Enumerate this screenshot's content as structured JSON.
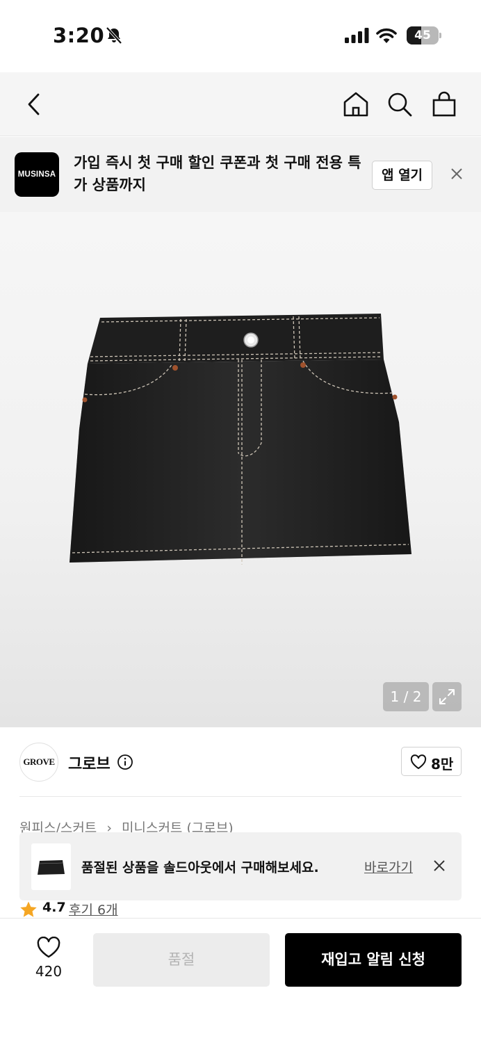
{
  "status_bar": {
    "time": "3:20",
    "battery_percent": "45",
    "battery_level": 0.45
  },
  "nav": {
    "icons": [
      "back-icon",
      "home-icon",
      "search-icon",
      "cart-icon"
    ]
  },
  "app_banner": {
    "logo_text": "MUSINSA",
    "message": "가입 즉시 첫 구매 할인 쿠폰과 첫 구매 전용 특가 상품까지",
    "open_label": "앱 열기"
  },
  "gallery": {
    "page_indicator": "1 / 2"
  },
  "brand": {
    "logo_text": "GROVE",
    "name": "그로브",
    "likes": "8만"
  },
  "breadcrumb": {
    "category": "원피스/스커트",
    "subcategory": "미니스커트 (그로브)"
  },
  "toast": {
    "message": "품절된 상품을 솔드아웃에서 구매해보세요.",
    "link_label": "바로가기"
  },
  "rating": {
    "value": "4.7",
    "review_label": "후기 6개"
  },
  "bottom_bar": {
    "wish_count": "420",
    "soldout_label": "품절",
    "restock_label": "재입고 알림 신청"
  },
  "colors": {
    "accent": "#000000",
    "star": "#f5a623",
    "disabled_bg": "#ececec"
  }
}
